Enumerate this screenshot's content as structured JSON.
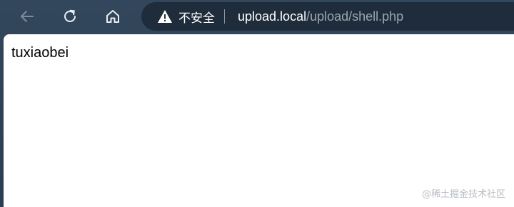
{
  "toolbar": {
    "back_icon": "arrow-left-icon",
    "reload_icon": "reload-icon",
    "home_icon": "home-icon"
  },
  "omnibox": {
    "security_icon": "warning-triangle-icon",
    "security_label": "不安全",
    "url_host": "upload.local",
    "url_path": "/upload/shell.php"
  },
  "page": {
    "body_text": "tuxiaobei"
  },
  "watermark": "@稀土掘金技术社区",
  "colors": {
    "toolbar_bg": "#33475c",
    "omnibox_bg": "#1f2c3b",
    "url_host": "#ffffff",
    "url_path": "#9aa7b4"
  }
}
